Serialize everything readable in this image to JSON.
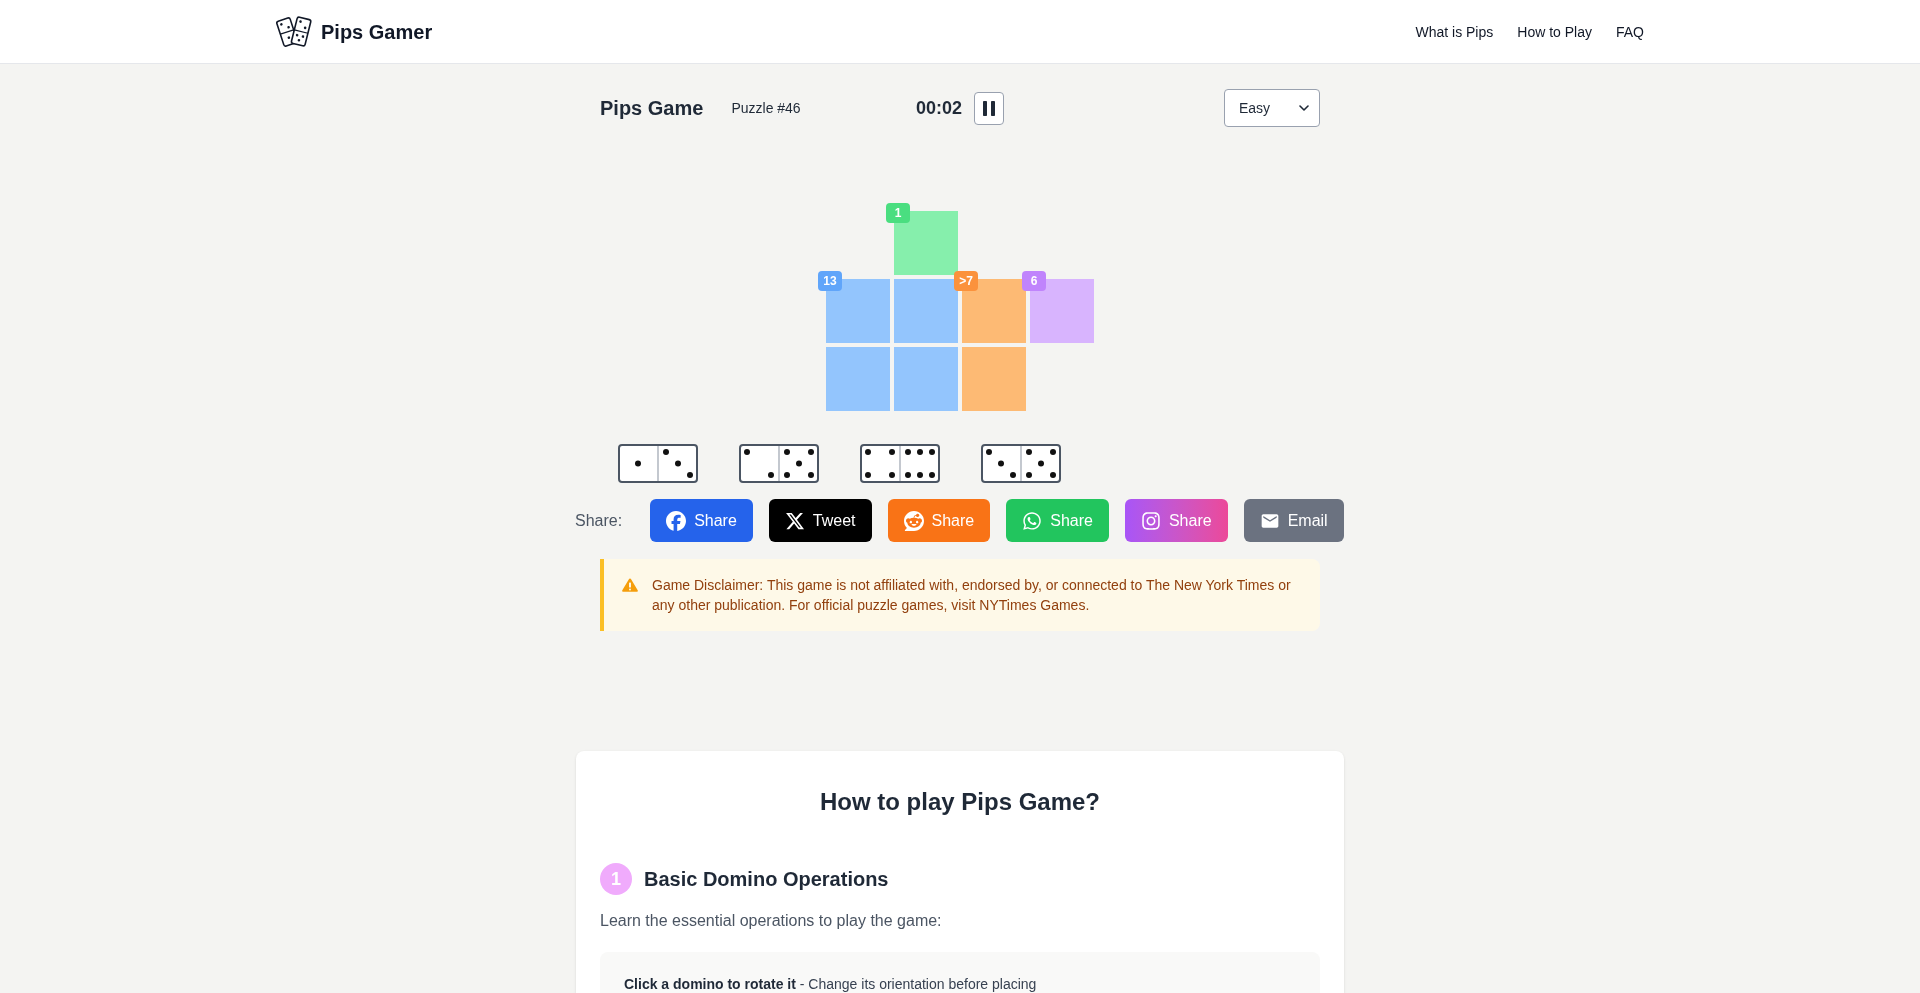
{
  "header": {
    "brand": "Pips Gamer",
    "nav": [
      {
        "label": "What is Pips"
      },
      {
        "label": "How to Play"
      },
      {
        "label": "FAQ"
      }
    ]
  },
  "game": {
    "title": "Pips Game",
    "puzzle": "Puzzle #46",
    "timer": "00:02",
    "paused": false,
    "difficulty": {
      "value": "Easy"
    },
    "board": {
      "rows": [
        {
          "cells": [
            {
              "kind": "blank"
            },
            {
              "kind": "cell",
              "color": "#86efac",
              "badge": {
                "text": "1",
                "color": "#4ade80"
              }
            }
          ]
        },
        {
          "cells": [
            {
              "kind": "cell",
              "color": "#93c5fd",
              "badge": {
                "text": "13",
                "color": "#60a5fa"
              }
            },
            {
              "kind": "cell",
              "color": "#93c5fd"
            },
            {
              "kind": "cell",
              "color": "#fdba74",
              "badge": {
                "text": ">7",
                "color": "#fb923c"
              }
            },
            {
              "kind": "cell",
              "color": "#d8b4fe",
              "badge": {
                "text": "6",
                "color": "#c084fc"
              }
            }
          ]
        },
        {
          "cells": [
            {
              "kind": "cell",
              "color": "#93c5fd"
            },
            {
              "kind": "cell",
              "color": "#93c5fd"
            },
            {
              "kind": "cell",
              "color": "#fdba74"
            }
          ]
        }
      ]
    },
    "dominoes": [
      {
        "halves": [
          {
            "kind": "one"
          },
          {
            "kind": "three"
          }
        ]
      },
      {
        "halves": [
          {
            "kind": "two"
          },
          {
            "kind": "five"
          }
        ]
      },
      {
        "halves": [
          {
            "kind": "four"
          },
          {
            "kind": "six"
          }
        ]
      },
      {
        "halves": [
          {
            "kind": "three"
          },
          {
            "kind": "five"
          }
        ]
      }
    ]
  },
  "share": {
    "label": "Share:",
    "buttons": [
      {
        "kind": "facebook",
        "label": "Share"
      },
      {
        "kind": "x",
        "label": "Tweet"
      },
      {
        "kind": "reddit",
        "label": "Share"
      },
      {
        "kind": "whatsapp",
        "label": "Share"
      },
      {
        "kind": "instagram",
        "label": "Share"
      },
      {
        "kind": "email",
        "label": "Email"
      }
    ]
  },
  "disclaimer": {
    "text": "Game Disclaimer: This game is not affiliated with, endorsed by, or connected to The New York Times or any other publication. For official puzzle games, visit NYTimes Games."
  },
  "how_to_play": {
    "title": "How to play Pips Game?",
    "steps": [
      {
        "number": "1",
        "title": "Basic Domino Operations",
        "intro": "Learn the essential operations to play the game:",
        "tips": [
          {
            "text": "**Click a domino to rotate it** - Change its orientation before placing"
          }
        ]
      }
    ]
  }
}
